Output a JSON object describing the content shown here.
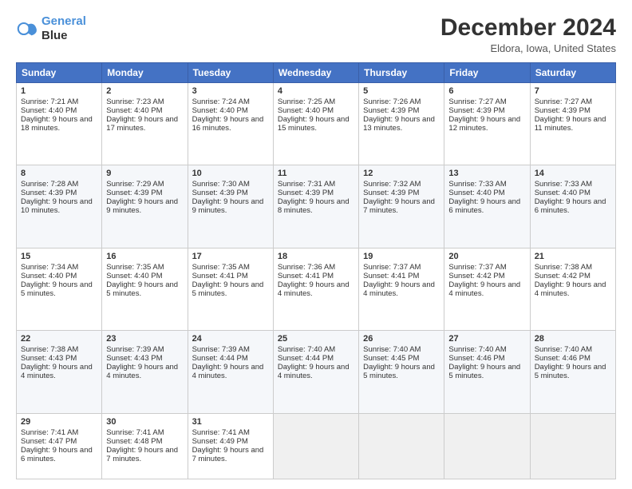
{
  "header": {
    "logo_line1": "General",
    "logo_line2": "Blue",
    "month": "December 2024",
    "location": "Eldora, Iowa, United States"
  },
  "days_of_week": [
    "Sunday",
    "Monday",
    "Tuesday",
    "Wednesday",
    "Thursday",
    "Friday",
    "Saturday"
  ],
  "weeks": [
    [
      {
        "day": "1",
        "sunrise": "7:21 AM",
        "sunset": "4:40 PM",
        "daylight": "9 hours and 18 minutes."
      },
      {
        "day": "2",
        "sunrise": "7:23 AM",
        "sunset": "4:40 PM",
        "daylight": "9 hours and 17 minutes."
      },
      {
        "day": "3",
        "sunrise": "7:24 AM",
        "sunset": "4:40 PM",
        "daylight": "9 hours and 16 minutes."
      },
      {
        "day": "4",
        "sunrise": "7:25 AM",
        "sunset": "4:40 PM",
        "daylight": "9 hours and 15 minutes."
      },
      {
        "day": "5",
        "sunrise": "7:26 AM",
        "sunset": "4:39 PM",
        "daylight": "9 hours and 13 minutes."
      },
      {
        "day": "6",
        "sunrise": "7:27 AM",
        "sunset": "4:39 PM",
        "daylight": "9 hours and 12 minutes."
      },
      {
        "day": "7",
        "sunrise": "7:27 AM",
        "sunset": "4:39 PM",
        "daylight": "9 hours and 11 minutes."
      }
    ],
    [
      {
        "day": "8",
        "sunrise": "7:28 AM",
        "sunset": "4:39 PM",
        "daylight": "9 hours and 10 minutes."
      },
      {
        "day": "9",
        "sunrise": "7:29 AM",
        "sunset": "4:39 PM",
        "daylight": "9 hours and 9 minutes."
      },
      {
        "day": "10",
        "sunrise": "7:30 AM",
        "sunset": "4:39 PM",
        "daylight": "9 hours and 9 minutes."
      },
      {
        "day": "11",
        "sunrise": "7:31 AM",
        "sunset": "4:39 PM",
        "daylight": "9 hours and 8 minutes."
      },
      {
        "day": "12",
        "sunrise": "7:32 AM",
        "sunset": "4:39 PM",
        "daylight": "9 hours and 7 minutes."
      },
      {
        "day": "13",
        "sunrise": "7:33 AM",
        "sunset": "4:40 PM",
        "daylight": "9 hours and 6 minutes."
      },
      {
        "day": "14",
        "sunrise": "7:33 AM",
        "sunset": "4:40 PM",
        "daylight": "9 hours and 6 minutes."
      }
    ],
    [
      {
        "day": "15",
        "sunrise": "7:34 AM",
        "sunset": "4:40 PM",
        "daylight": "9 hours and 5 minutes."
      },
      {
        "day": "16",
        "sunrise": "7:35 AM",
        "sunset": "4:40 PM",
        "daylight": "9 hours and 5 minutes."
      },
      {
        "day": "17",
        "sunrise": "7:35 AM",
        "sunset": "4:41 PM",
        "daylight": "9 hours and 5 minutes."
      },
      {
        "day": "18",
        "sunrise": "7:36 AM",
        "sunset": "4:41 PM",
        "daylight": "9 hours and 4 minutes."
      },
      {
        "day": "19",
        "sunrise": "7:37 AM",
        "sunset": "4:41 PM",
        "daylight": "9 hours and 4 minutes."
      },
      {
        "day": "20",
        "sunrise": "7:37 AM",
        "sunset": "4:42 PM",
        "daylight": "9 hours and 4 minutes."
      },
      {
        "day": "21",
        "sunrise": "7:38 AM",
        "sunset": "4:42 PM",
        "daylight": "9 hours and 4 minutes."
      }
    ],
    [
      {
        "day": "22",
        "sunrise": "7:38 AM",
        "sunset": "4:43 PM",
        "daylight": "9 hours and 4 minutes."
      },
      {
        "day": "23",
        "sunrise": "7:39 AM",
        "sunset": "4:43 PM",
        "daylight": "9 hours and 4 minutes."
      },
      {
        "day": "24",
        "sunrise": "7:39 AM",
        "sunset": "4:44 PM",
        "daylight": "9 hours and 4 minutes."
      },
      {
        "day": "25",
        "sunrise": "7:40 AM",
        "sunset": "4:44 PM",
        "daylight": "9 hours and 4 minutes."
      },
      {
        "day": "26",
        "sunrise": "7:40 AM",
        "sunset": "4:45 PM",
        "daylight": "9 hours and 5 minutes."
      },
      {
        "day": "27",
        "sunrise": "7:40 AM",
        "sunset": "4:46 PM",
        "daylight": "9 hours and 5 minutes."
      },
      {
        "day": "28",
        "sunrise": "7:40 AM",
        "sunset": "4:46 PM",
        "daylight": "9 hours and 5 minutes."
      }
    ],
    [
      {
        "day": "29",
        "sunrise": "7:41 AM",
        "sunset": "4:47 PM",
        "daylight": "9 hours and 6 minutes."
      },
      {
        "day": "30",
        "sunrise": "7:41 AM",
        "sunset": "4:48 PM",
        "daylight": "9 hours and 7 minutes."
      },
      {
        "day": "31",
        "sunrise": "7:41 AM",
        "sunset": "4:49 PM",
        "daylight": "9 hours and 7 minutes."
      },
      null,
      null,
      null,
      null
    ]
  ],
  "labels": {
    "sunrise": "Sunrise: ",
    "sunset": "Sunset: ",
    "daylight": "Daylight: "
  }
}
